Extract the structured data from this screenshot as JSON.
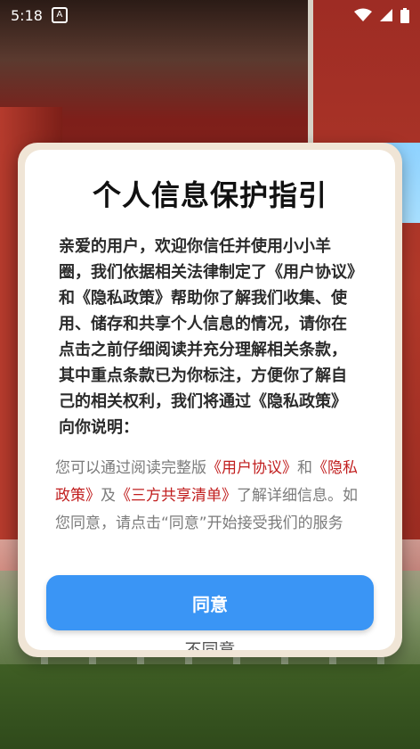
{
  "status_bar": {
    "time": "5:18",
    "notification_icon": "a-notification-icon",
    "icons": [
      "wifi-icon",
      "signal-icon",
      "battery-icon"
    ]
  },
  "dialog": {
    "title": "个人信息保护指引",
    "main_text": "亲爱的用户，欢迎你信任并使用小小羊圈，我们依据相关法律制定了《用户协议》和《隐私政策》帮助你了解我们收集、使用、储存和共享个人信息的情况，请你在点击之前仔细阅读并充分理解相关条款，其中重点条款已为你标注，方便你了解自己的相关权利，我们将通过《隐私政策》向你说明：",
    "sub_text": {
      "part1": "您可以通过阅读完整版",
      "link_user_agreement": "《用户协议》",
      "part2": "和",
      "link_privacy_policy": "《隐私政策》",
      "part3": "及",
      "link_third_party": "《三方共享清单》",
      "part4": "了解详细信息。如您同意，请点击“同意”开始接受我们的服务"
    },
    "agree_label": "同意",
    "disagree_label": "不同意"
  },
  "colors": {
    "accent": "#3a95f5",
    "link": "#c11e1e",
    "dialog_frame": "#f0e5d6"
  }
}
